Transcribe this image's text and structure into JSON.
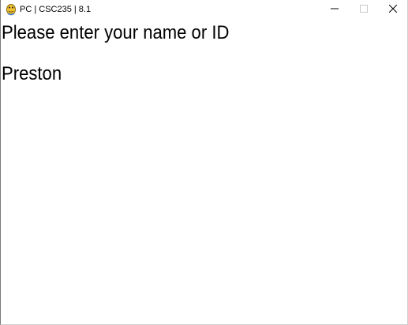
{
  "window": {
    "title": "PC | CSC235 | 8.1",
    "icon": "python-snake-icon",
    "controls": {
      "minimize": "minimize-icon",
      "maximize": "maximize-icon",
      "close": "close-icon"
    }
  },
  "content": {
    "prompt": "Please enter your name or ID",
    "name_value": "Preston"
  }
}
